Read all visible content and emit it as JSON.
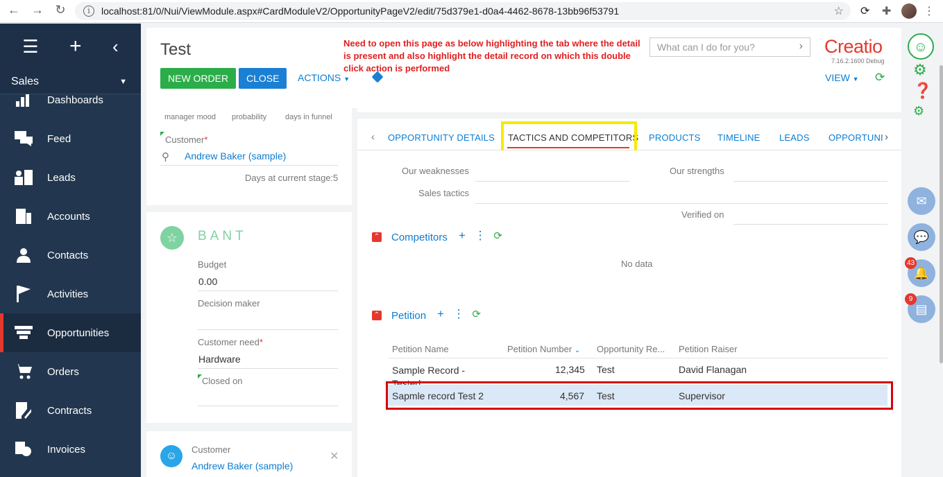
{
  "browser": {
    "url": "localhost:81/0/Nui/ViewModule.aspx#CardModuleV2/OpportunityPageV2/edit/75d379e1-d0a4-4462-8678-13bb96f53791"
  },
  "sidebar": {
    "section": "Sales",
    "items": [
      {
        "label": "Dashboards",
        "icon": "dashboards-icon"
      },
      {
        "label": "Feed",
        "icon": "feed-icon"
      },
      {
        "label": "Leads",
        "icon": "leads-icon"
      },
      {
        "label": "Accounts",
        "icon": "accounts-icon"
      },
      {
        "label": "Contacts",
        "icon": "contacts-icon"
      },
      {
        "label": "Activities",
        "icon": "flag-icon"
      },
      {
        "label": "Opportunities",
        "icon": "funnel-icon",
        "active": true
      },
      {
        "label": "Orders",
        "icon": "cart-icon"
      },
      {
        "label": "Contracts",
        "icon": "contract-icon"
      },
      {
        "label": "Invoices",
        "icon": "invoice-icon"
      }
    ]
  },
  "header": {
    "title": "Test",
    "new_order": "NEW ORDER",
    "close": "CLOSE",
    "actions": "ACTIONS",
    "note": "Need to open this page as below highlighting the tab where the detail is present and also highlight the detail record on which this double click action is performed",
    "search_placeholder": "What can I do for you?",
    "logo": "Creatio",
    "version": "7.16.2.1600 Debug",
    "view": "VIEW"
  },
  "profile_card": {
    "gauges": [
      "manager mood",
      "probability",
      "days in funnel"
    ],
    "customer_label": "Customer",
    "customer_value": "Andrew Baker (sample)",
    "days_label": "Days at current stage:",
    "days_value": "5"
  },
  "bant": {
    "title": "BANT",
    "budget_label": "Budget",
    "budget_value": "0.00",
    "decision_label": "Decision maker",
    "need_label": "Customer need",
    "need_value": "Hardware",
    "closed_label": "Closed on"
  },
  "contact_card": {
    "label": "Customer",
    "value": "Andrew Baker (sample)"
  },
  "tabs": [
    "OPPORTUNITY DETAILS",
    "TACTICS AND COMPETITORS",
    "PRODUCTS",
    "TIMELINE",
    "LEADS",
    "OPPORTUNI"
  ],
  "tactics": {
    "weaknesses": "Our weaknesses",
    "strengths": "Our strengths",
    "sales_tactics": "Sales tactics",
    "verified_on": "Verified on"
  },
  "competitors": {
    "title": "Competitors",
    "empty": "No data"
  },
  "petition": {
    "title": "Petition",
    "columns": [
      "Petition Name",
      "Petition Number",
      "Opportunity Re...",
      "Petition Raiser"
    ],
    "rows": [
      {
        "name": "Sample Record - Tested",
        "number": "12,345",
        "opportunity": "Test",
        "raiser": "David Flanagan"
      },
      {
        "name": "Sapmle record Test 2",
        "number": "4,567",
        "opportunity": "Test",
        "raiser": "Supervisor"
      }
    ]
  },
  "rail": {
    "notifications_count": "43",
    "tasks_count": "9"
  },
  "colors": {
    "sidebar": "#22374f",
    "accent_red": "#e4382d",
    "green": "#2bad4a",
    "blue": "#1b7fd4",
    "highlight_yellow": "#f6ea00",
    "highlight_red": "#d7000f"
  }
}
